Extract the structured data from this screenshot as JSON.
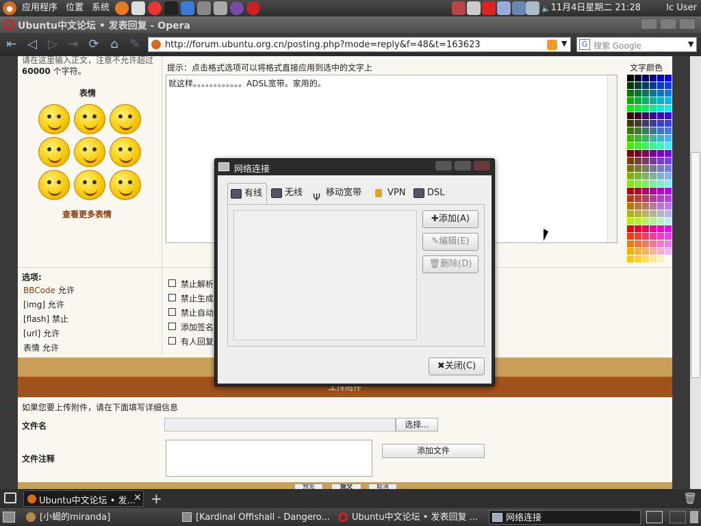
{
  "top_panel": {
    "menus": [
      "应用程序",
      "位置",
      "系统"
    ],
    "clock": "11月4日星期二 21:28",
    "user": "lc User"
  },
  "window": {
    "title": "Ubuntu中文论坛 • 发表回复 - Opera"
  },
  "toolbar": {
    "url": "http://forum.ubuntu.org.cn/posting.php?mode=reply&f=48&t=163623",
    "search_placeholder": "搜索 Google"
  },
  "page": {
    "char_limit_text": "请在这里输入正文，注意不允许超过",
    "char_limit_count": "60000",
    "char_limit_suffix": "个字符。",
    "hint": "提示：点击格式选项可以将格式直接应用到选中的文字上",
    "font_color_label": "文字颜色",
    "emoticons_title": "表情",
    "more_emoticons": "查看更多表情",
    "message_text": "就这样。。。。。。。。。。。。ADSL宽带。家用的。",
    "options_title": "选项:",
    "options": [
      {
        "link": "BBCode",
        "status": "允许"
      },
      {
        "link": "[img]",
        "status": "允许"
      },
      {
        "link": "[flash]",
        "status": "禁止"
      },
      {
        "link": "[url]",
        "status": "允许"
      },
      {
        "link": "表情",
        "status": "允许"
      }
    ],
    "checkboxes": [
      "禁止解析",
      "禁止生成",
      "禁止自动",
      "添加签名",
      "有人回复"
    ],
    "attach_header": "上传附件",
    "attach_hint": "如果您要上传附件，请在下面填写详细信息",
    "filename_label": "文件名",
    "browse_button": "选择...",
    "file_comment_label": "文件注释",
    "add_file_button": "添加文件",
    "bottom_buttons": [
      "预览",
      "提交",
      "取消"
    ]
  },
  "dialog": {
    "title": "网络连接",
    "tabs": [
      "有线",
      "无线",
      "移动宽带",
      "VPN",
      "DSL"
    ],
    "add_button": "添加(A)",
    "edit_button": "编辑(E)",
    "delete_button": "删除(D)",
    "close_button": "关闭(C)"
  },
  "taskbar_top": {
    "tab_title": "Ubuntu中文论坛 • 发..."
  },
  "taskbar": {
    "items": [
      "[小蝎的miranda]",
      "[Kardinal Offishall - Dangero...",
      "Ubuntu中文论坛 • 发表回复 ...",
      "网络连接"
    ]
  },
  "colors": {
    "panel": "#3a3a3a",
    "accent": "#c8a05a",
    "attach_bar": "#a0521b"
  }
}
